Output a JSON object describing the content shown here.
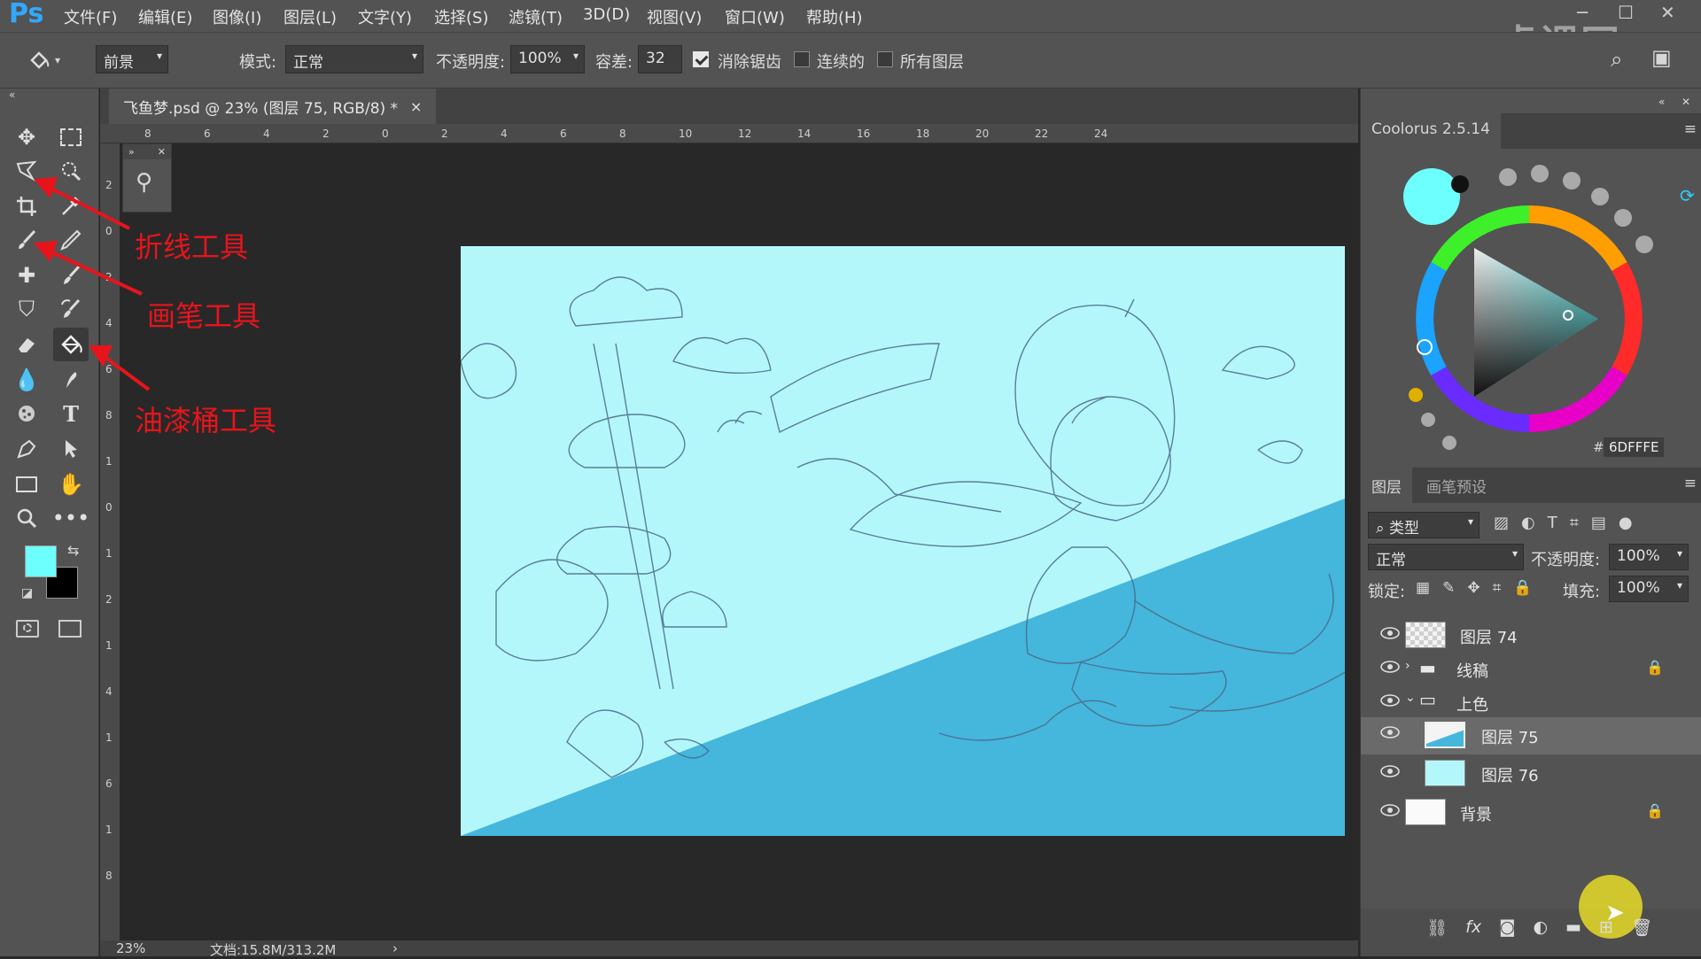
{
  "app": {
    "logo": "Ps"
  },
  "menu": [
    "文件(F)",
    "编辑(E)",
    "图像(I)",
    "图层(L)",
    "文字(Y)",
    "选择(S)",
    "滤镜(T)",
    "3D(D)",
    "视图(V)",
    "窗口(W)",
    "帮助(H)"
  ],
  "watermark": "虎课网",
  "options": {
    "fill_source": "前景",
    "mode_label": "模式:",
    "mode_value": "正常",
    "opacity_label": "不透明度:",
    "opacity_value": "100%",
    "tolerance_label": "容差:",
    "tolerance_value": "32",
    "antialias_label": "消除锯齿",
    "antialias_checked": true,
    "contiguous_label": "连续的",
    "contiguous_checked": false,
    "all_layers_label": "所有图层",
    "all_layers_checked": false
  },
  "document": {
    "tab_title": "飞鱼梦.psd @ 23% (图层 75, RGB/8) *",
    "close_glyph": "×",
    "zoom": "23%",
    "doc_info": "文档:15.8M/313.2M",
    "ruler_h": [
      "8",
      "6",
      "4",
      "2",
      "0",
      "2",
      "4",
      "6",
      "8",
      "10",
      "12",
      "14",
      "16",
      "18",
      "20",
      "22",
      "24"
    ],
    "ruler_v": [
      "2",
      "0",
      "2",
      "4",
      "6",
      "8",
      "1",
      "0",
      "1",
      "2",
      "1",
      "4",
      "1",
      "6",
      "1",
      "8"
    ]
  },
  "colors": {
    "foreground": "#6DFFFE",
    "background": "#000000",
    "sea": "#45b6dc",
    "sky": "#b4f7fb"
  },
  "annotations": {
    "lasso": "折线工具",
    "brush": "画笔工具",
    "bucket": "油漆桶工具"
  },
  "coolorus": {
    "title": "Coolorus 2.5.14",
    "hex": "6DFFFE",
    "hash": "#"
  },
  "layers_panel": {
    "tab_layers": "图层",
    "tab_brush_presets": "画笔预设",
    "filter_kind": "类型",
    "blend_mode": "正常",
    "opacity_label": "不透明度:",
    "opacity_value": "100%",
    "lock_label": "锁定:",
    "fill_label": "填充:",
    "fill_value": "100%",
    "layers": [
      {
        "name": "图层 74",
        "kind": "layer"
      },
      {
        "name": "线稿",
        "kind": "group-collapsed"
      },
      {
        "name": "上色",
        "kind": "group-expanded"
      },
      {
        "name": "图层 75",
        "kind": "layer-selected"
      },
      {
        "name": "图层 76",
        "kind": "layer"
      },
      {
        "name": "背景",
        "kind": "background"
      }
    ]
  },
  "icons": [
    "move-icon",
    "marquee-icon",
    "polygonal-lasso-icon",
    "quick-select-icon",
    "crop-icon",
    "eyedropper-icon",
    "brush-icon",
    "pencil-icon",
    "healing-icon",
    "mixer-brush-icon",
    "stamp-icon",
    "history-brush-icon",
    "eraser-icon",
    "paint-bucket-icon",
    "blur-icon",
    "smudge-icon",
    "sponge-icon",
    "type-icon",
    "pen-icon",
    "path-select-icon",
    "rectangle-icon",
    "hand-icon",
    "zoom-icon",
    "more-icon"
  ]
}
